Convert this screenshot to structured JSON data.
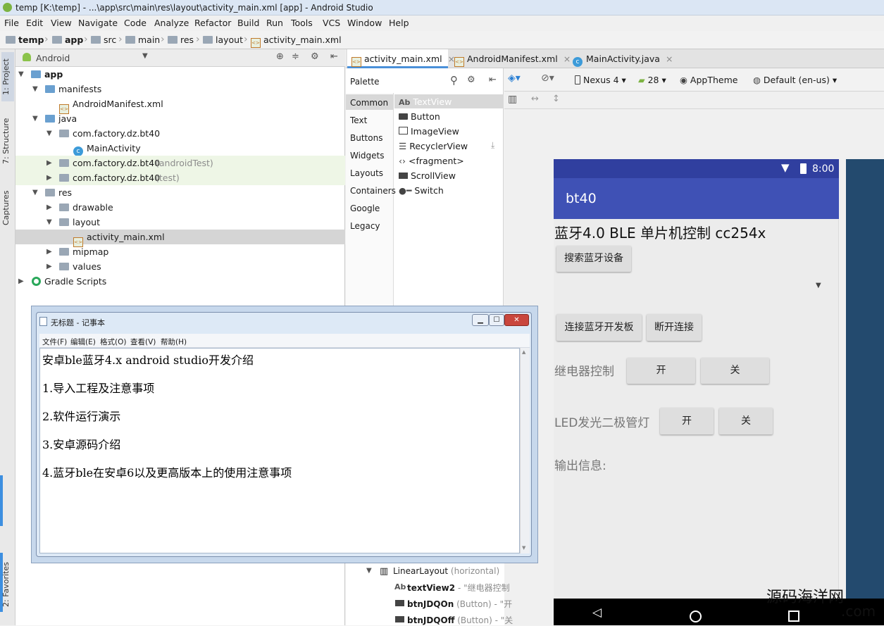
{
  "window": {
    "title": "temp [K:\\temp] - ...\\app\\src\\main\\res\\layout\\activity_main.xml [app] - Android Studio"
  },
  "menu": [
    "File",
    "Edit",
    "View",
    "Navigate",
    "Code",
    "Analyze",
    "Refactor",
    "Build",
    "Run",
    "Tools",
    "VCS",
    "Window",
    "Help"
  ],
  "breadcrumb": [
    "temp",
    "app",
    "src",
    "main",
    "res",
    "layout",
    "activity_main.xml"
  ],
  "side_tabs": {
    "project": "1: Project",
    "structure": "7: Structure",
    "captures": "Captures",
    "favorites": "2: Favorites"
  },
  "project": {
    "view_mode": "Android",
    "tree": [
      {
        "label": "app",
        "sub": ""
      },
      {
        "label": "manifests",
        "sub": ""
      },
      {
        "label": "AndroidManifest.xml",
        "sub": ""
      },
      {
        "label": "java",
        "sub": ""
      },
      {
        "label": "com.factory.dz.bt40",
        "sub": ""
      },
      {
        "label": "MainActivity",
        "sub": ""
      },
      {
        "label": "com.factory.dz.bt40",
        "sub": "(androidTest)"
      },
      {
        "label": "com.factory.dz.bt40",
        "sub": "(test)"
      },
      {
        "label": "res",
        "sub": ""
      },
      {
        "label": "drawable",
        "sub": ""
      },
      {
        "label": "layout",
        "sub": ""
      },
      {
        "label": "activity_main.xml",
        "sub": ""
      },
      {
        "label": "mipmap",
        "sub": ""
      },
      {
        "label": "values",
        "sub": ""
      },
      {
        "label": "Gradle Scripts",
        "sub": ""
      }
    ]
  },
  "editor_tabs": [
    "activity_main.xml",
    "AndroidManifest.xml",
    "MainActivity.java"
  ],
  "palette": {
    "title": "Palette",
    "categories": [
      "Common",
      "Text",
      "Buttons",
      "Widgets",
      "Layouts",
      "Containers",
      "Google",
      "Legacy"
    ],
    "items": [
      "TextView",
      "Button",
      "ImageView",
      "RecyclerView",
      "<fragment>",
      "ScrollView",
      "Switch"
    ]
  },
  "design_toolbar": {
    "device": "Nexus 4",
    "api": "28",
    "theme": "AppTheme",
    "locale": "Default (en-us)"
  },
  "phone": {
    "time": "8:00",
    "app_title": "bt40",
    "heading": "蓝牙4.0 BLE 单片机控制  cc254x",
    "search_button": "搜索蓝牙设备",
    "connect_button": "连接蓝牙开发板",
    "disconnect_button": "断开连接",
    "relay_label": "继电器控制",
    "relay_on": "开",
    "relay_off": "关",
    "led_label": "LED发光二极管灯",
    "led_on": "开",
    "led_off": "关",
    "output_label": "输出信息:"
  },
  "notepad": {
    "title": "无标题 - 记事本",
    "menu": [
      "文件(F)",
      "编辑(E)",
      "格式(O)",
      "查看(V)",
      "帮助(H)"
    ],
    "lines": [
      "安卓ble蓝牙4.x android studio开发介绍",
      "1.导入工程及注意事项",
      "2.软件运行演示",
      "3.安卓源码介绍",
      "4.蓝牙ble在安卓6以及更高版本上的使用注意事项"
    ]
  },
  "component_tree": [
    {
      "name": "LinearLayout",
      "sub": "(horizontal)"
    },
    {
      "name": "textView2",
      "sub": "- \"继电器控制"
    },
    {
      "name": "btnJDQOn",
      "sub": "(Button) - \"开"
    },
    {
      "name": "btnJDQOff",
      "sub": "(Button) - \"关"
    }
  ],
  "watermark": "源码海洋网\n.com",
  "colors": {
    "primary": "#3f51b5",
    "primary_dark": "#303f9f",
    "accent_tab": "#4a90d9"
  }
}
